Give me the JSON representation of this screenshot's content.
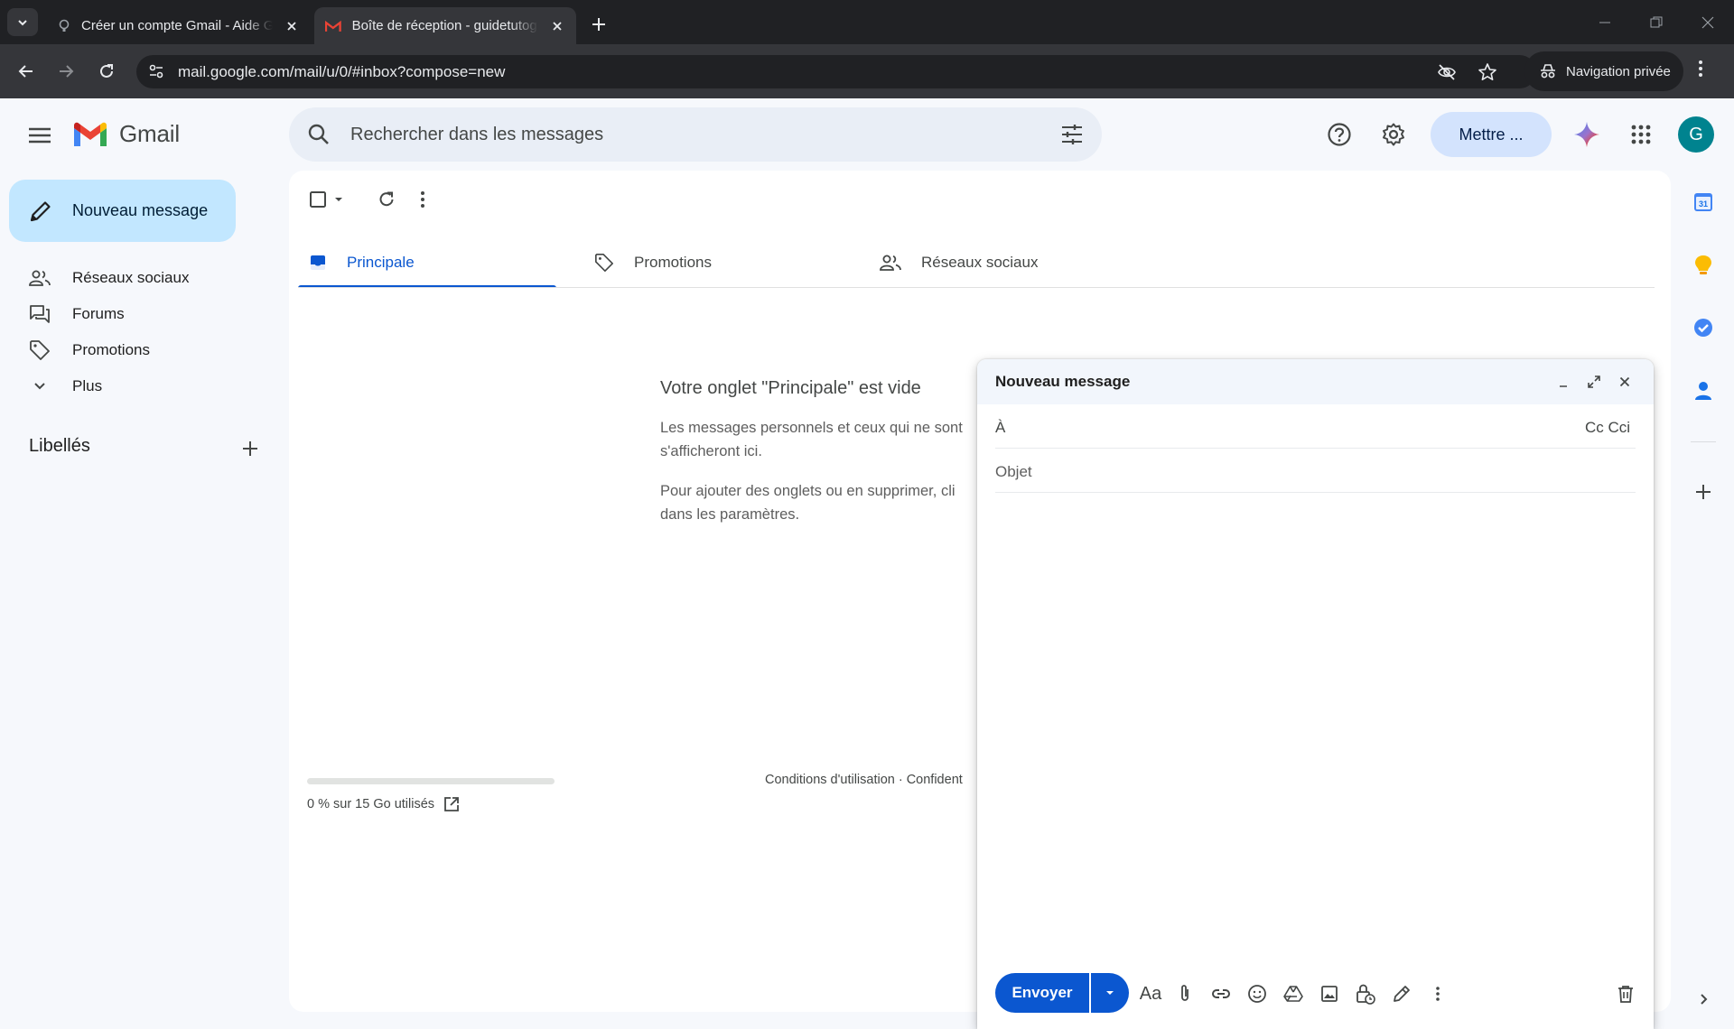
{
  "browser": {
    "tabs": [
      {
        "title": "Créer un compte Gmail - Aide Gmail",
        "active": false
      },
      {
        "title": "Boîte de réception - guidetutogmail",
        "active": true
      }
    ],
    "url": "mail.google.com/mail/u/0/#inbox?compose=new",
    "incognito_label": "Navigation privée"
  },
  "header": {
    "app_name": "Gmail",
    "search_placeholder": "Rechercher dans les messages",
    "upgrade_label": "Mettre ...",
    "avatar_letter": "G"
  },
  "sidebar": {
    "compose_label": "Nouveau message",
    "items": [
      {
        "label": "Réseaux sociaux",
        "icon": "people-icon"
      },
      {
        "label": "Forums",
        "icon": "forum-icon"
      },
      {
        "label": "Promotions",
        "icon": "tag-icon"
      },
      {
        "label": "Plus",
        "icon": "chevron-down-icon"
      }
    ],
    "labels_title": "Libellés"
  },
  "inbox": {
    "tabs": [
      {
        "label": "Principale",
        "active": true
      },
      {
        "label": "Promotions",
        "active": false
      },
      {
        "label": "Réseaux sociaux",
        "active": false
      }
    ],
    "empty_title": "Votre onglet \"Principale\" est vide",
    "empty_p1": "Les messages personnels et ceux qui ne sont",
    "empty_p1b": "s'afficheront ici.",
    "empty_p2": "Pour ajouter des onglets ou en supprimer, cli",
    "empty_p2b": "dans les paramètres.",
    "storage_text": "0 % sur 15 Go utilisés",
    "storage_fraction": 0,
    "footer": "Conditions d'utilisation · Confident"
  },
  "side_panel": {
    "calendar_day": "31"
  },
  "compose": {
    "title": "Nouveau message",
    "to_label": "À",
    "to_value": "",
    "cc_label": "Cc Cci",
    "subject_placeholder": "Objet",
    "subject_value": "",
    "send_label": "Envoyer",
    "format_label": "Aa"
  },
  "colors": {
    "accent": "#0b57d0",
    "compose_button": "#c2e7ff",
    "upgrade_button": "#d3e3fd",
    "avatar": "#00838f"
  }
}
